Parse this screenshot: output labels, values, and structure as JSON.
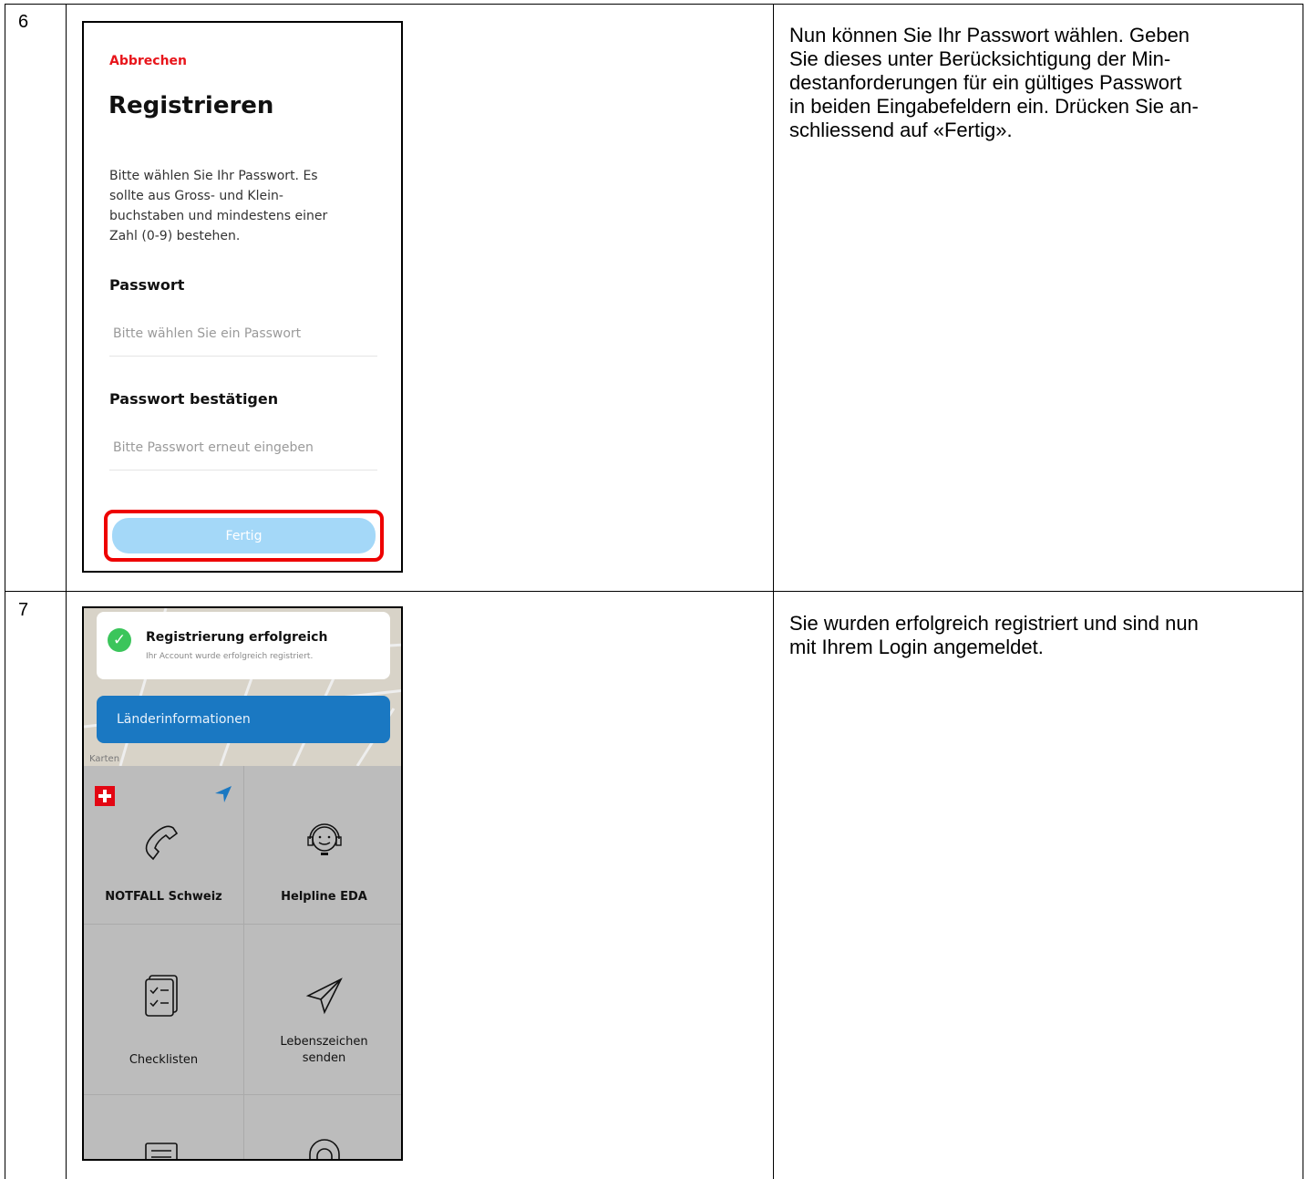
{
  "steps": [
    {
      "number": "6",
      "description_lines": [
        "Nun können Sie Ihr Passwort wählen. Geben",
        "Sie dieses unter Berücksichtigung der Min-",
        "destanforderungen für ein gültiges Passwort",
        "in beiden Eingabefeldern ein. Drücken Sie an-",
        "schliessend auf «Fertig»."
      ],
      "screen": {
        "cancel_label": "Abbrechen",
        "title": "Registrieren",
        "intro_lines": [
          "Bitte wählen Sie Ihr Passwort. Es",
          "sollte aus Gross- und Klein-",
          "buchstaben und mindestens einer",
          "Zahl (0-9) bestehen."
        ],
        "password_label": "Passwort",
        "password_placeholder": "Bitte wählen Sie ein Passwort",
        "password_value": "",
        "confirm_label": "Passwort bestätigen",
        "confirm_placeholder": "Bitte Passwort erneut eingeben",
        "confirm_value": "",
        "done_label": "Fertig",
        "highlight_color": "#e00000"
      }
    },
    {
      "number": "7",
      "description_lines": [
        "Sie wurden erfolgreich registriert und sind nun",
        "mit Ihrem Login angemeldet."
      ],
      "screen": {
        "toast_title": "Registrierung erfolgreich",
        "toast_subtitle": "Ihr Account wurde erfolgreich registriert.",
        "country_button": "Länderinformationen",
        "maps_label": "Karten",
        "tiles": [
          {
            "label": "NOTFALL Schweiz",
            "icon": "phone-icon"
          },
          {
            "label": "Helpline EDA",
            "icon": "headset-icon"
          },
          {
            "label": "Checklisten",
            "icon": "checklist-icon"
          },
          {
            "label_lines": [
              "Lebenszeichen",
              "senden"
            ],
            "icon": "paper-plane-icon"
          }
        ],
        "accent_color": "#1a78c2",
        "success_color": "#3bc55b"
      }
    }
  ]
}
